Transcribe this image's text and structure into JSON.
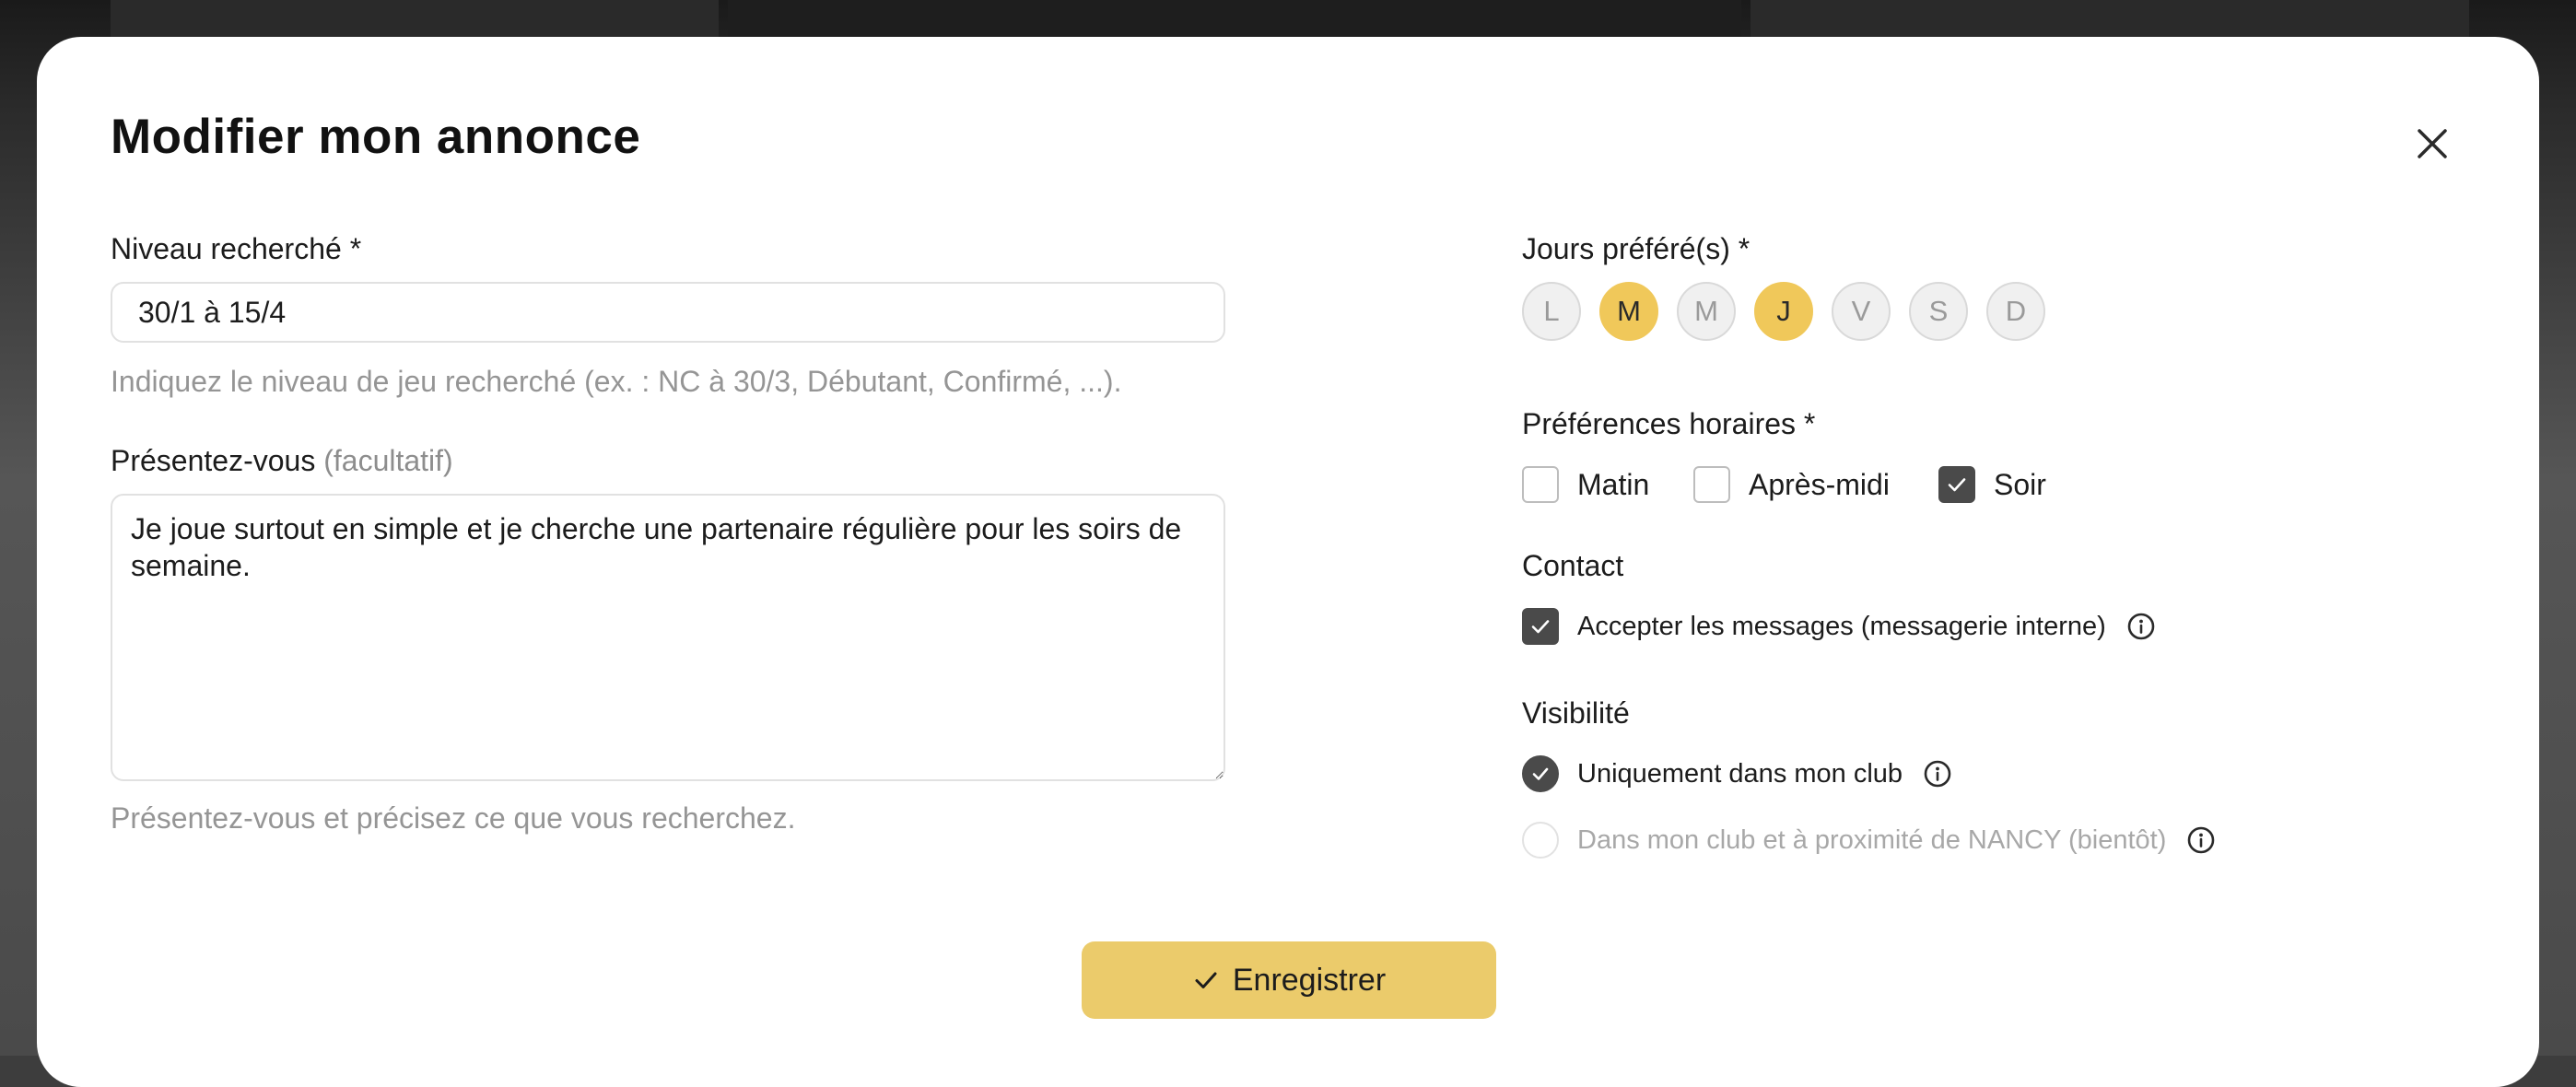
{
  "modal": {
    "title": "Modifier mon annonce"
  },
  "form": {
    "level": {
      "label": "Niveau recherché *",
      "value": "30/1 à 15/4",
      "help": "Indiquez le niveau de jeu recherché (ex. : NC à 30/3, Débutant, Confirmé, ...)."
    },
    "intro": {
      "label": "Présentez-vous",
      "optional": "(facultatif)",
      "value": "Je joue surtout en simple et je cherche une partenaire régulière pour les soirs de semaine.",
      "help": "Présentez-vous et précisez ce que vous recherchez."
    },
    "days": {
      "label": "Jours préféré(s) *",
      "items": [
        {
          "letter": "L",
          "selected": false
        },
        {
          "letter": "M",
          "selected": true
        },
        {
          "letter": "M",
          "selected": false
        },
        {
          "letter": "J",
          "selected": true
        },
        {
          "letter": "V",
          "selected": false
        },
        {
          "letter": "S",
          "selected": false
        },
        {
          "letter": "D",
          "selected": false
        }
      ]
    },
    "time": {
      "label": "Préférences horaires *",
      "options": [
        {
          "label": "Matin",
          "checked": false
        },
        {
          "label": "Après-midi",
          "checked": false
        },
        {
          "label": "Soir",
          "checked": true
        }
      ]
    },
    "contact": {
      "label": "Contact",
      "accept_messages": {
        "label": "Accepter les messages (messagerie interne)",
        "checked": true
      }
    },
    "visibility": {
      "label": "Visibilité",
      "options": [
        {
          "label": "Uniquement dans mon club",
          "selected": true,
          "disabled": false
        },
        {
          "label": "Dans mon club et à proximité de NANCY (bientôt)",
          "selected": false,
          "disabled": true
        }
      ]
    },
    "save_label": "Enregistrer"
  },
  "colors": {
    "accent": "#ebcb6b",
    "day_selected": "#f0c85a",
    "checked": "#4a4a4a"
  },
  "icons": [
    "close-icon",
    "check-icon",
    "info-icon",
    "checkmark-icon"
  ]
}
